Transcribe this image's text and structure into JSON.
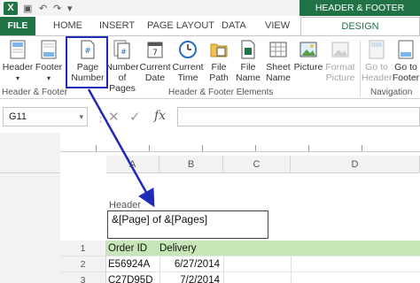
{
  "titlebar": {
    "app_icon": "excel-logo-icon",
    "app_icon_letter": "X",
    "contextual_title": "HEADER & FOOTER TOOLS"
  },
  "tabs": [
    {
      "label": "FILE"
    },
    {
      "label": "HOME"
    },
    {
      "label": "INSERT"
    },
    {
      "label": "PAGE LAYOUT"
    },
    {
      "label": "DATA"
    },
    {
      "label": "VIEW"
    },
    {
      "label": "DESIGN"
    }
  ],
  "ribbon": {
    "groups": [
      {
        "label": "Header & Footer"
      },
      {
        "label": "Header & Footer Elements"
      },
      {
        "label": "Navigation"
      }
    ],
    "buttons": [
      {
        "line1": "Header",
        "line2": "",
        "icon": "header-icon"
      },
      {
        "line1": "Footer",
        "line2": "",
        "icon": "footer-icon"
      },
      {
        "line1": "Page",
        "line2": "Number",
        "icon": "page-number-icon"
      },
      {
        "line1": "Number",
        "line2": "of Pages",
        "icon": "number-of-pages-icon"
      },
      {
        "line1": "Current",
        "line2": "Date",
        "icon": "calendar-icon"
      },
      {
        "line1": "Current",
        "line2": "Time",
        "icon": "clock-icon"
      },
      {
        "line1": "File",
        "line2": "Path",
        "icon": "file-path-icon"
      },
      {
        "line1": "File",
        "line2": "Name",
        "icon": "file-name-icon"
      },
      {
        "line1": "Sheet",
        "line2": "Name",
        "icon": "sheet-name-icon"
      },
      {
        "line1": "Picture",
        "line2": "",
        "icon": "picture-icon"
      },
      {
        "line1": "Format",
        "line2": "Picture",
        "icon": "format-picture-icon"
      },
      {
        "line1": "Go to",
        "line2": "Header",
        "icon": "go-to-header-icon"
      },
      {
        "line1": "Go to",
        "line2": "Footer",
        "icon": "go-to-footer-icon"
      }
    ]
  },
  "formula_bar": {
    "name_box": "G11",
    "cancel_glyph": "✕",
    "enter_glyph": "✓",
    "fx": "fx",
    "value": ""
  },
  "sheet": {
    "columns": [
      "A",
      "B",
      "C",
      "D"
    ],
    "header_label": "Header",
    "header_text": "&[Page] of &[Pages]",
    "rows": [
      {
        "num": "1",
        "a": "Order ID",
        "b": "Delivery"
      },
      {
        "num": "2",
        "a": "E56924A",
        "b": "6/27/2014"
      },
      {
        "num": "3",
        "a": "C27D95D",
        "b": "7/2/2014"
      }
    ]
  },
  "colors": {
    "excel_green": "#217346",
    "callout_blue": "#1f2bb8",
    "header_row_fill": "#c6e6b8"
  }
}
